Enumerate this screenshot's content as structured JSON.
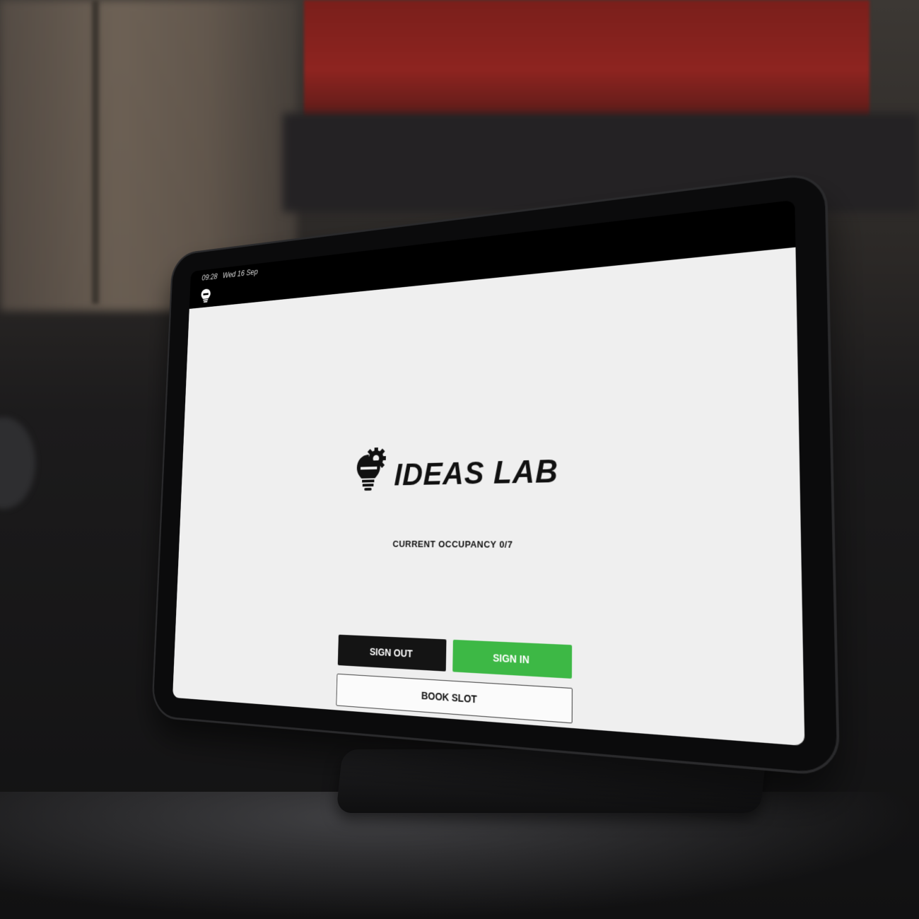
{
  "status_bar": {
    "time": "09:28",
    "date": "Wed 16 Sep"
  },
  "nav": {
    "icon": "lightbulb-icon"
  },
  "brand": {
    "logo_icon": "lightbulb-gear-icon",
    "name": "IDEAS LAB"
  },
  "occupancy": {
    "text": "CURRENT OCCUPANCY 0/7",
    "current": 0,
    "capacity": 7
  },
  "actions": {
    "sign_out": "SIGN OUT",
    "sign_in": "SIGN IN",
    "book_slot": "BOOK SLOT"
  },
  "colors": {
    "sign_in": "#3db845",
    "sign_out": "#141414",
    "screen_bg": "#efefef"
  }
}
